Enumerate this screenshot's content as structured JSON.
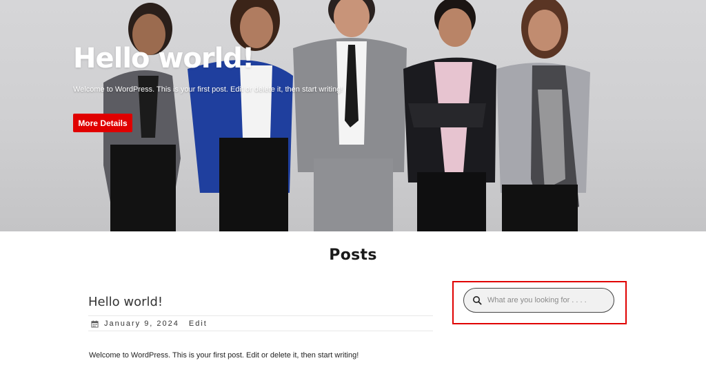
{
  "hero": {
    "title": "Hello world!",
    "text": "Welcome to WordPress. This is your first post. Edit or delete it, then start writing!",
    "button_label": "More Details"
  },
  "section": {
    "title": "Posts"
  },
  "post": {
    "title": "Hello world!",
    "date": "January 9, 2024",
    "edit_label": "Edit",
    "excerpt": "Welcome to WordPress. This is your first post. Edit or delete it, then start writing!",
    "date_icon": "calendar-icon"
  },
  "search": {
    "placeholder": "What are you looking for . . . .",
    "icon": "search-icon"
  },
  "colors": {
    "accent": "#e00000",
    "highlight": "#e00000"
  }
}
